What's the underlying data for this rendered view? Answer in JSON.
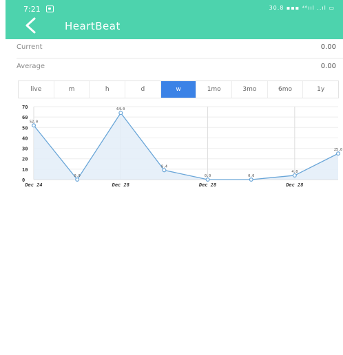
{
  "status": {
    "time": "7:21",
    "right": "30.8 ▪▪▪ ⁴⁶ııl ..ıl ▭"
  },
  "header": {
    "title": "HeartBeat"
  },
  "stats": {
    "current_label": "Current",
    "current_value": "0.00",
    "average_label": "Average",
    "average_value": "0.00"
  },
  "ranges": [
    "live",
    "m",
    "h",
    "d",
    "w",
    "1mo",
    "3mo",
    "6mo",
    "1y"
  ],
  "active_range": "w",
  "colors": {
    "appbar": "#4dd3ad",
    "active": "#3b82e6",
    "line": "#6aa6d8",
    "fill": "#e3edf8"
  },
  "icons": {
    "back": "chevron-left-icon",
    "notification": "notification-icon"
  },
  "chart_data": {
    "type": "area",
    "y_ticks": [
      0,
      10,
      20,
      30,
      40,
      50,
      60,
      70
    ],
    "ylim": [
      0,
      70
    ],
    "x_tick_labels": [
      "Dec 24",
      "Dec 28",
      "Dec 28",
      "Dec 28"
    ],
    "values": [
      52,
      0,
      64,
      9,
      0,
      0,
      4,
      25
    ],
    "value_labels": [
      "52.0",
      "0.0",
      "64.0",
      "9.4",
      "0.0",
      "0.0",
      "4.0",
      "25.0"
    ],
    "grid": true
  }
}
